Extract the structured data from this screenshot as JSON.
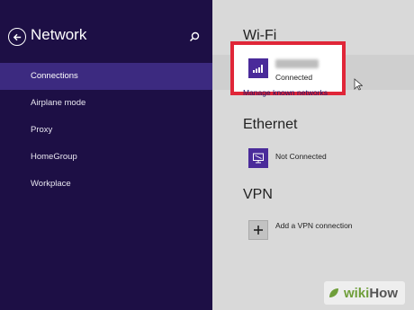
{
  "colors": {
    "sidebar_bg": "#1d0f45",
    "sidebar_active": "#3c2a80",
    "tile_purple": "#4a2b9a",
    "highlight_red": "#e02638"
  },
  "sidebar": {
    "title": "Network",
    "back_icon": "back-arrow-circle-icon",
    "search_icon": "search-icon",
    "items": [
      {
        "label": "Connections",
        "active": true
      },
      {
        "label": "Airplane mode",
        "active": false
      },
      {
        "label": "Proxy",
        "active": false
      },
      {
        "label": "HomeGroup",
        "active": false
      },
      {
        "label": "Workplace",
        "active": false
      }
    ]
  },
  "wifi": {
    "heading": "Wi-Fi",
    "icon": "wifi-signal-icon",
    "network_name": "",
    "status": "Connected",
    "manage_link": "Manage known networks"
  },
  "ethernet": {
    "heading": "Ethernet",
    "icon": "ethernet-monitor-icon",
    "status": "Not Connected"
  },
  "vpn": {
    "heading": "VPN",
    "icon": "plus-icon",
    "add_label": "Add a VPN connection"
  },
  "watermark": {
    "wiki": "wiki",
    "how": "How"
  }
}
